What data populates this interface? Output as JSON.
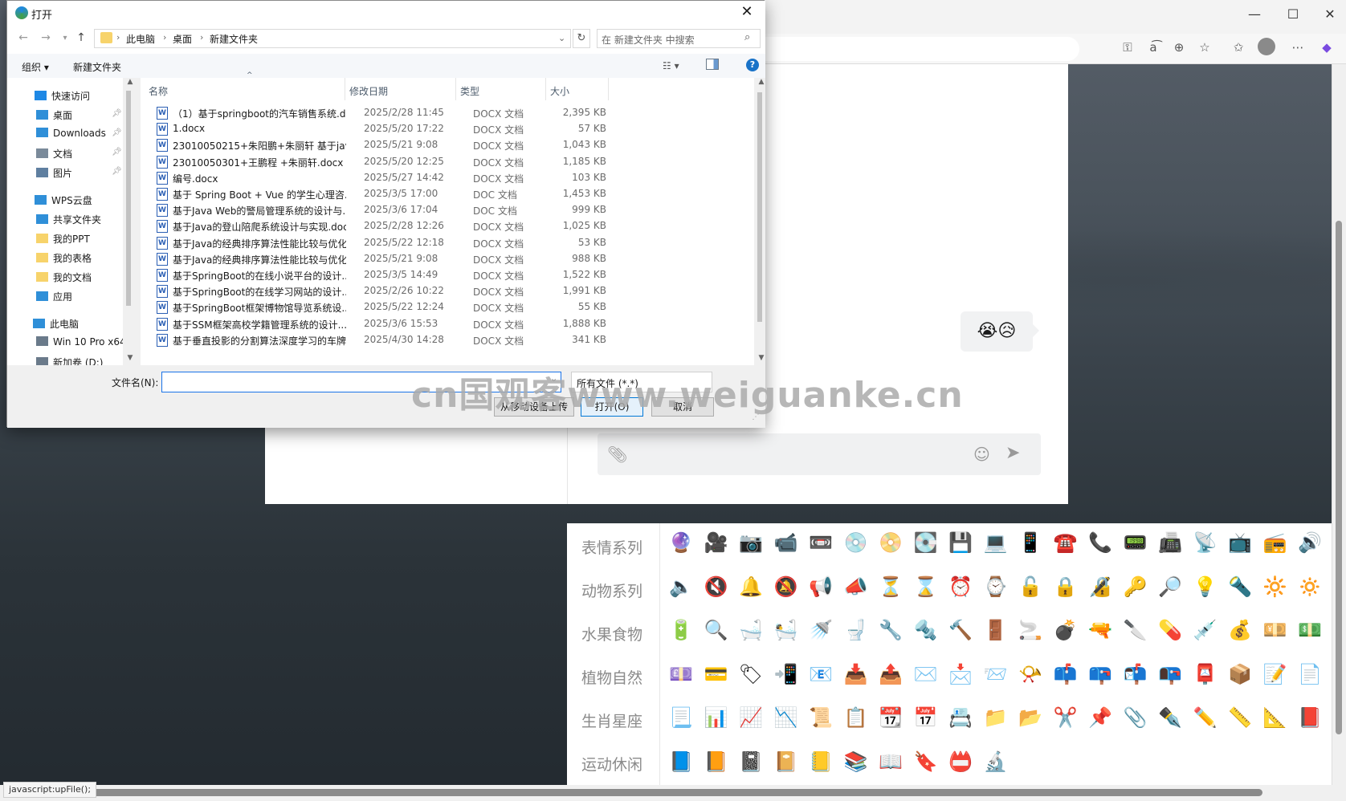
{
  "browser": {
    "window_controls": [
      "—",
      "☐",
      "✕"
    ],
    "toolbar_icons": [
      "key-icon",
      "read-aloud-icon",
      "zoom-icon",
      "favorite-star-icon",
      "favorites-icon",
      "profile-icon",
      "more-icon",
      "copilot-icon"
    ],
    "status_text": "javascript:upFile();"
  },
  "chat": {
    "emoji_bubble": "😭😥",
    "input_placeholder": ""
  },
  "emoji_panel": {
    "categories": [
      "表情系列",
      "动物系列",
      "水果食物",
      "植物自然",
      "生肖星座",
      "运动休闲"
    ],
    "rows": [
      [
        "🔮",
        "🎥",
        "📷",
        "📹",
        "📼",
        "💿",
        "📀",
        "💽",
        "💾",
        "💻",
        "📱",
        "☎️",
        "📞",
        "📟",
        "📠",
        "📡",
        "📺",
        "📻",
        "🔊"
      ],
      [
        "🔈",
        "🔇",
        "🔔",
        "🔕",
        "📢",
        "📣",
        "⏳",
        "⌛",
        "⏰",
        "⌚",
        "🔓",
        "🔒",
        "🔏",
        "🔑",
        "🔎",
        "💡",
        "🔦",
        "🔆",
        "🔅"
      ],
      [
        "🔋",
        "🔍",
        "🛁",
        "🛀",
        "🚿",
        "🚽",
        "🔧",
        "🔩",
        "🔨",
        "🚪",
        "🚬",
        "💣",
        "🔫",
        "🔪",
        "💊",
        "💉",
        "💰",
        "💴",
        "💵"
      ],
      [
        "💷",
        "💳",
        "🏷",
        "📲",
        "📧",
        "📥",
        "📤",
        "✉️",
        "📩",
        "📨",
        "📯",
        "📫",
        "📪",
        "📬",
        "📭",
        "📮",
        "📦",
        "📝",
        "📄"
      ],
      [
        "📃",
        "📊",
        "📈",
        "📉",
        "📜",
        "📋",
        "📆",
        "📅",
        "📇",
        "📁",
        "📂",
        "✂️",
        "📌",
        "📎",
        "✒️",
        "✏️",
        "📏",
        "📐",
        "📕"
      ],
      [
        "📘",
        "📙",
        "📓",
        "📔",
        "📒",
        "📚",
        "📖",
        "🔖",
        "📛",
        "🔬"
      ]
    ]
  },
  "watermark": "cn国观客www.weiguanke.cn",
  "dialog": {
    "title": "打开",
    "close": "✕",
    "breadcrumb": [
      "此电脑",
      "桌面",
      "新建文件夹"
    ],
    "search_placeholder": "在 新建文件夹 中搜索",
    "commands": {
      "organize": "组织 ▾",
      "new_folder": "新建文件夹",
      "view": "☷ ▾"
    },
    "nav": [
      {
        "label": "快速访问",
        "icon": "star-icon",
        "color": "#1e88e5",
        "pinned": false
      },
      {
        "label": "桌面",
        "icon": "desktop-icon",
        "color": "#2f8fd8",
        "pinned": true
      },
      {
        "label": "Downloads",
        "icon": "download-icon",
        "color": "#2f8fd8",
        "pinned": true
      },
      {
        "label": "文档",
        "icon": "document-icon",
        "color": "#7a8a9a",
        "pinned": true
      },
      {
        "label": "图片",
        "icon": "pictures-icon",
        "color": "#5f7fa0",
        "pinned": true
      },
      {
        "label": "WPS云盘",
        "icon": "cloud-icon",
        "color": "#2f8fd8",
        "pinned": false
      },
      {
        "label": "共享文件夹",
        "icon": "share-icon",
        "color": "#2f8fd8",
        "pinned": false
      },
      {
        "label": "我的PPT",
        "icon": "folder-icon",
        "color": "#f7d36b",
        "pinned": false
      },
      {
        "label": "我的表格",
        "icon": "folder-icon",
        "color": "#f7d36b",
        "pinned": false
      },
      {
        "label": "我的文档",
        "icon": "folder-icon",
        "color": "#f7d36b",
        "pinned": false
      },
      {
        "label": "应用",
        "icon": "apps-icon",
        "color": "#2f8fd8",
        "pinned": false
      },
      {
        "label": "此电脑",
        "icon": "computer-icon",
        "color": "#2f8fd8",
        "pinned": false
      },
      {
        "label": "Win 10 Pro x64",
        "icon": "drive-icon",
        "color": "#6a7a8a",
        "pinned": false
      },
      {
        "label": "新加卷 (D:)",
        "icon": "drive-icon",
        "color": "#6a7a8a",
        "pinned": false
      }
    ],
    "columns": {
      "name": "名称",
      "date": "修改日期",
      "type": "类型",
      "size": "大小"
    },
    "files": [
      {
        "name": "（1）基于springboot的汽车销售系统.d...",
        "date": "2025/2/28 11:45",
        "type": "DOCX 文档",
        "size": "2,395 KB"
      },
      {
        "name": "1.docx",
        "date": "2025/5/20 17:22",
        "type": "DOCX 文档",
        "size": "57 KB"
      },
      {
        "name": "23010050215+朱阳鹏+朱丽轩 基于jav...",
        "date": "2025/5/21 9:08",
        "type": "DOCX 文档",
        "size": "1,043 KB"
      },
      {
        "name": "23010050301+王鹏程 +朱丽轩.docx",
        "date": "2025/5/20 12:25",
        "type": "DOCX 文档",
        "size": "1,185 KB"
      },
      {
        "name": "编号.docx",
        "date": "2025/5/27 14:42",
        "type": "DOCX 文档",
        "size": "103 KB"
      },
      {
        "name": "基于 Spring Boot + Vue 的学生心理咨...",
        "date": "2025/3/5 17:00",
        "type": "DOC 文档",
        "size": "1,453 KB"
      },
      {
        "name": "基于Java Web的警局管理系统的设计与...",
        "date": "2025/3/6 17:04",
        "type": "DOC 文档",
        "size": "999 KB"
      },
      {
        "name": "基于Java的登山陪爬系统设计与实现.docx",
        "date": "2025/2/28 12:26",
        "type": "DOCX 文档",
        "size": "1,025 KB"
      },
      {
        "name": "基于Java的经典排序算法性能比较与优化...",
        "date": "2025/5/22 12:18",
        "type": "DOCX 文档",
        "size": "53 KB"
      },
      {
        "name": "基于Java的经典排序算法性能比较与优化...",
        "date": "2025/5/21 9:08",
        "type": "DOCX 文档",
        "size": "988 KB"
      },
      {
        "name": "基于SpringBoot的在线小说平台的设计...",
        "date": "2025/3/5 14:49",
        "type": "DOCX 文档",
        "size": "1,522 KB"
      },
      {
        "name": "基于SpringBoot的在线学习网站的设计...",
        "date": "2025/2/26 10:22",
        "type": "DOCX 文档",
        "size": "1,991 KB"
      },
      {
        "name": "基于SpringBoot框架博物馆导览系统设...",
        "date": "2025/5/22 12:24",
        "type": "DOCX 文档",
        "size": "55 KB"
      },
      {
        "name": "基于SSM框架高校学籍管理系统的设计...",
        "date": "2025/3/6 15:53",
        "type": "DOCX 文档",
        "size": "1,888 KB"
      },
      {
        "name": "基于垂直投影的分割算法深度学习的车牌...",
        "date": "2025/4/30 14:28",
        "type": "DOCX 文档",
        "size": "341 KB"
      }
    ],
    "filename_label": "文件名(N):",
    "filename_value": "",
    "filetype": "所有文件 (*.*)",
    "buttons": {
      "upload": "从移动设备上传",
      "open": "打开(O)",
      "cancel": "取消"
    }
  }
}
